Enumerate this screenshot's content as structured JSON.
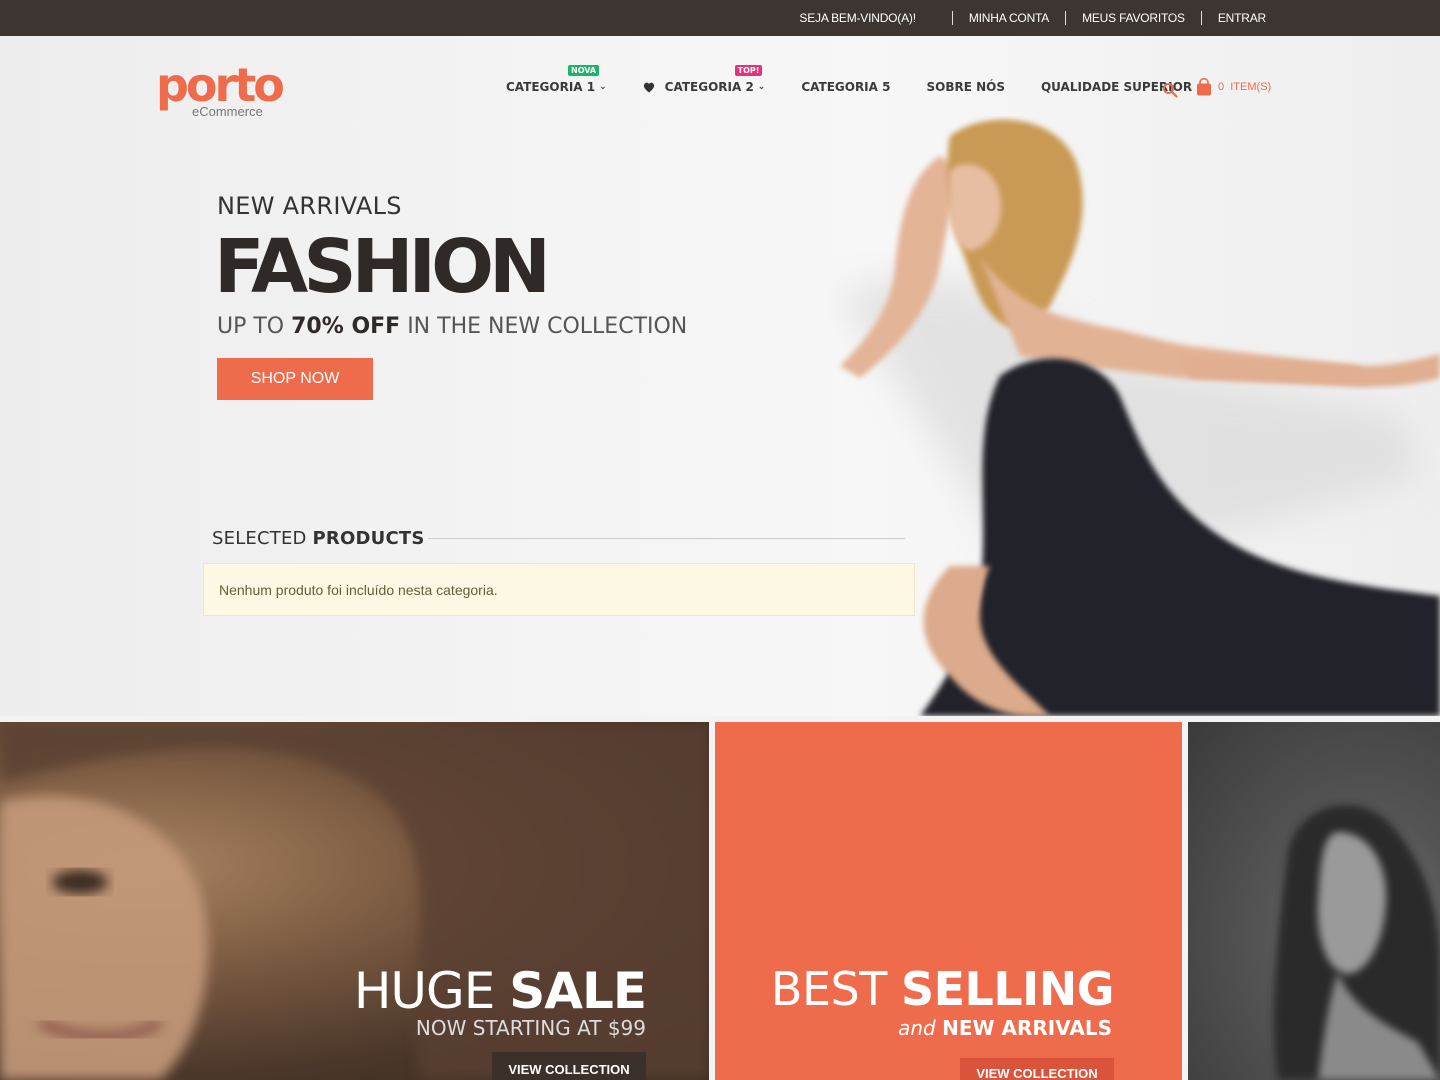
{
  "topbar": {
    "welcome": "SEJA BEM-VINDO(A)!",
    "links": [
      "MINHA CONTA",
      "MEUS FAVORITOS",
      "ENTRAR"
    ]
  },
  "header": {
    "logo_word": "porto",
    "logo_sub": "eCommerce",
    "nav": [
      {
        "label": "CATEGORIA 1",
        "badge": "NOVA",
        "badge_color": "#1fb26a",
        "dropdown": true
      },
      {
        "label": "CATEGORIA 2",
        "badge": "TOP!",
        "badge_color": "#e6317b",
        "dropdown": true,
        "icon": "heart-icon"
      },
      {
        "label": "CATEGORIA 5"
      },
      {
        "label": "SOBRE NÓS"
      },
      {
        "label": "QUALIDADE SUPERIOR"
      }
    ],
    "cart_count": "0",
    "cart_label": "ITEM(S)"
  },
  "hero": {
    "eyebrow": "NEW ARRIVALS",
    "title": "FASHION",
    "sub_pre": "UP TO ",
    "sub_bold": "70% OFF",
    "sub_post": " IN THE NEW COLLECTION",
    "button": "SHOP NOW"
  },
  "selected": {
    "title_light": "SELECTED ",
    "title_bold": "PRODUCTS",
    "notice": "Nenhum produto foi incluído nesta categoria."
  },
  "banners": {
    "b1": {
      "title_light": "HUGE ",
      "title_bold": "SALE",
      "sub": "NOW STARTING AT $99",
      "button": "VIEW COLLECTION"
    },
    "b2": {
      "title_light": "BEST ",
      "title_bold": "SELLING",
      "sub_italic": "and ",
      "sub_bold": "NEW ARRIVALS",
      "button": "VIEW COLLECTION"
    }
  },
  "colors": {
    "accent": "#ee6b4b",
    "topbar": "#3c3531",
    "notice_bg": "#fdf8e4"
  }
}
